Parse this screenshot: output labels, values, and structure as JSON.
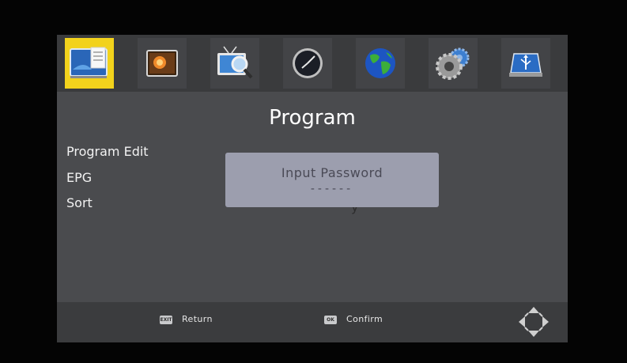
{
  "menu_tabs": [
    {
      "icon": "program-icon",
      "active": true
    },
    {
      "icon": "picture-icon",
      "active": false
    },
    {
      "icon": "channel-search-icon",
      "active": false
    },
    {
      "icon": "clock-icon",
      "active": false
    },
    {
      "icon": "globe-icon",
      "active": false
    },
    {
      "icon": "settings-icon",
      "active": false
    },
    {
      "icon": "usb-icon",
      "active": false
    }
  ],
  "page_title": "Program",
  "menu_items": [
    "Program Edit",
    "EPG",
    "Sort"
  ],
  "dialog": {
    "title": "Input Password",
    "password_mask": "------"
  },
  "footer": {
    "exit_key": "EXIT",
    "exit_label": "Return",
    "ok_key": "OK",
    "ok_label": "Confirm"
  },
  "colors": {
    "active_tab": "#f2d21c",
    "screen_bg": "#4a4b4e",
    "dialog_bg": "#9c9eae"
  }
}
